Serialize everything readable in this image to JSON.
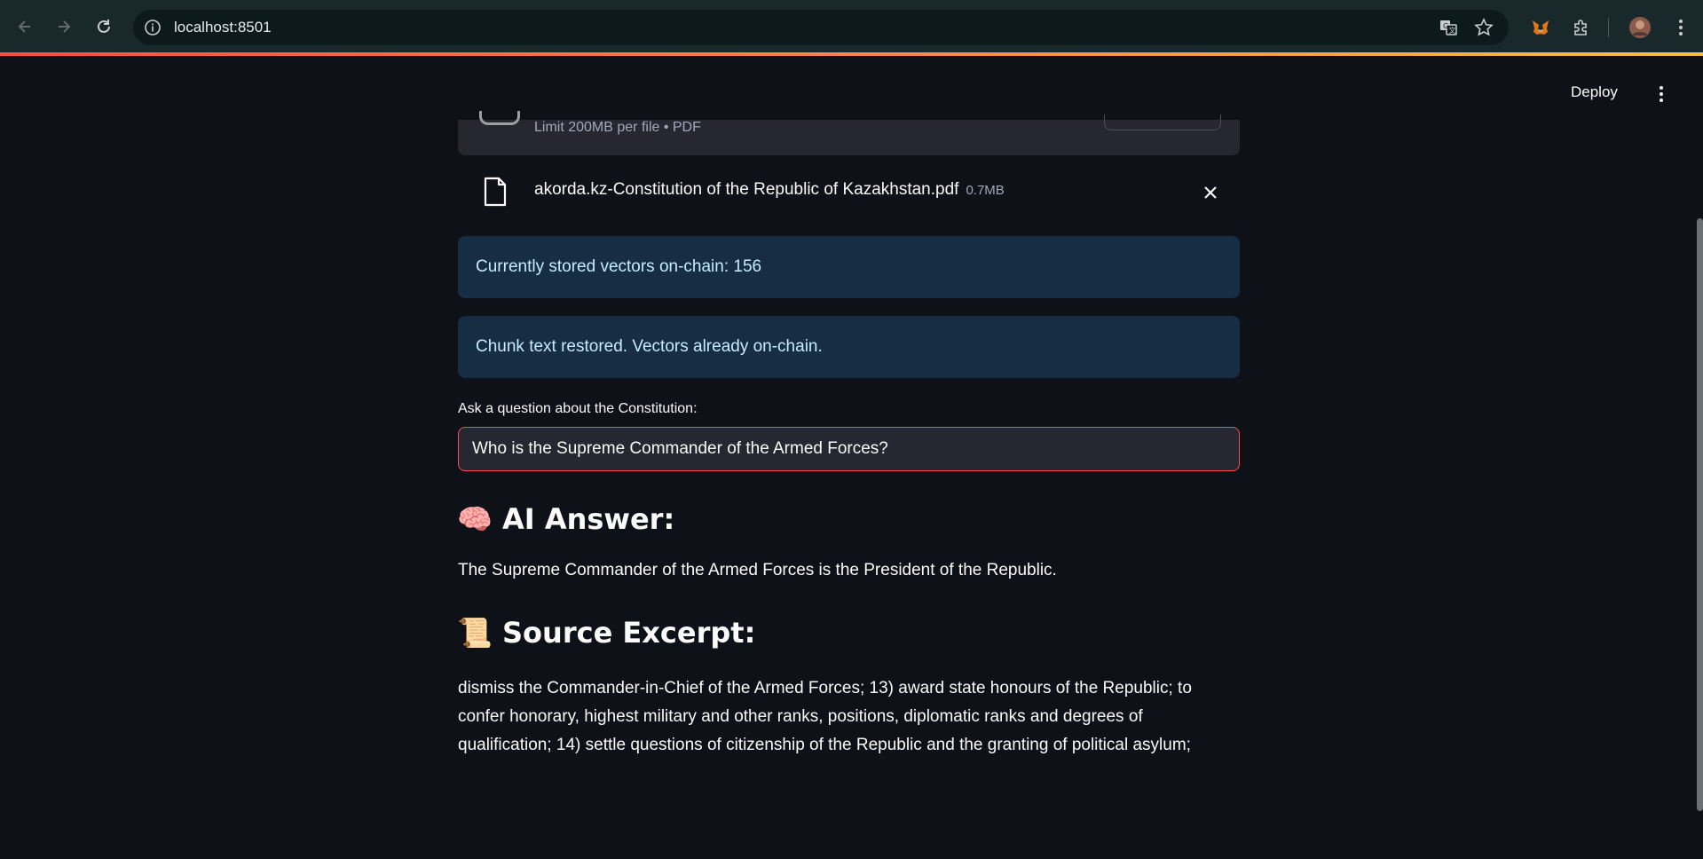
{
  "browser": {
    "url": "localhost:8501"
  },
  "header": {
    "deploy_label": "Deploy"
  },
  "uploader": {
    "limit_text": "Limit 200MB per file • PDF",
    "file_name": "akorda.kz-Constitution of the Republic of Kazakhstan.pdf",
    "file_size": "0.7MB"
  },
  "info": {
    "vectors_text": "Currently stored vectors on-chain: 156",
    "restored_text": "Chunk text restored. Vectors already on-chain."
  },
  "question": {
    "label": "Ask a question about the Constitution:",
    "value": "Who is the Supreme Commander of the Armed Forces?"
  },
  "answer": {
    "emoji": "🧠",
    "heading": "AI Answer:",
    "text": "The Supreme Commander of the Armed Forces is the President of the Republic."
  },
  "source": {
    "emoji": "📜",
    "heading": "Source Excerpt:",
    "text": "dismiss the Commander-in-Chief of the Armed Forces; 13) award state honours of the Republic; to confer honorary, highest military and other ranks, positions, diplomatic ranks and degrees of qualification; 14) settle questions of citizenship of the Republic and the granting of political asylum;"
  },
  "colors": {
    "background": "#0e1117",
    "info_bg": "#172d43",
    "info_text": "#c7ebff",
    "accent": "#ff4b4b"
  },
  "icons": [
    "back-icon",
    "forward-icon",
    "reload-icon",
    "site-info-icon",
    "translate-icon",
    "bookmark-star-icon",
    "metamask-extension-icon",
    "extensions-puzzle-icon",
    "profile-avatar",
    "chrome-menu-icon",
    "file-icon",
    "close-icon",
    "kebab-menu-icon"
  ]
}
